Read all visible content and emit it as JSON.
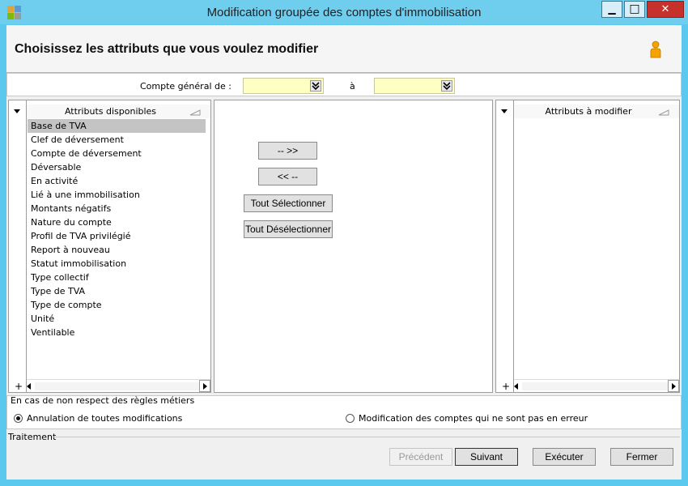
{
  "window": {
    "title": "Modification groupée des comptes d'immobilisation",
    "minimize_glyph": "▁",
    "maximize_glyph": "□",
    "close_glyph": "✕",
    "colors": {
      "titlebar": "#6fcdee",
      "close": "#c7312b"
    }
  },
  "header": {
    "heading": "Choisissez les attributs que vous voulez modifier",
    "icon": "user-icon"
  },
  "filter": {
    "label_from": "Compte général de :",
    "value_from": "",
    "label_to": "à",
    "value_to": "",
    "field_color": "#ffffc4"
  },
  "available": {
    "header": "Attributs disponibles",
    "items": [
      "Base de TVA",
      "Clef de déversement",
      "Compte de déversement",
      "Déversable",
      "En activité",
      "Lié à une immobilisation",
      "Montants négatifs",
      "Nature du compte",
      "Profil de TVA privilégié",
      "Report à nouveau",
      "Statut immobilisation",
      "Type collectif",
      "Type de TVA",
      "Type de compte",
      "Unité",
      "Ventilable"
    ],
    "selected_index": 0,
    "add_glyph": "+"
  },
  "transfer": {
    "add_label": "-- >>",
    "remove_label": "<< --",
    "select_all_label": "Tout Sélectionner",
    "deselect_all_label": "Tout Désélectionner"
  },
  "to_modify": {
    "header": "Attributs à modifier",
    "items": [],
    "add_glyph": "+"
  },
  "rules": {
    "caption": "En cas de non respect des règles métiers",
    "option_cancel": "Annulation de toutes modifications",
    "option_partial": "Modification des comptes qui ne sont pas en erreur",
    "selected": "cancel"
  },
  "processing": {
    "caption": "Traitement"
  },
  "footer": {
    "previous_label": "Précédent",
    "next_label": "Suivant",
    "execute_label": "Exécuter",
    "close_label": "Fermer"
  }
}
